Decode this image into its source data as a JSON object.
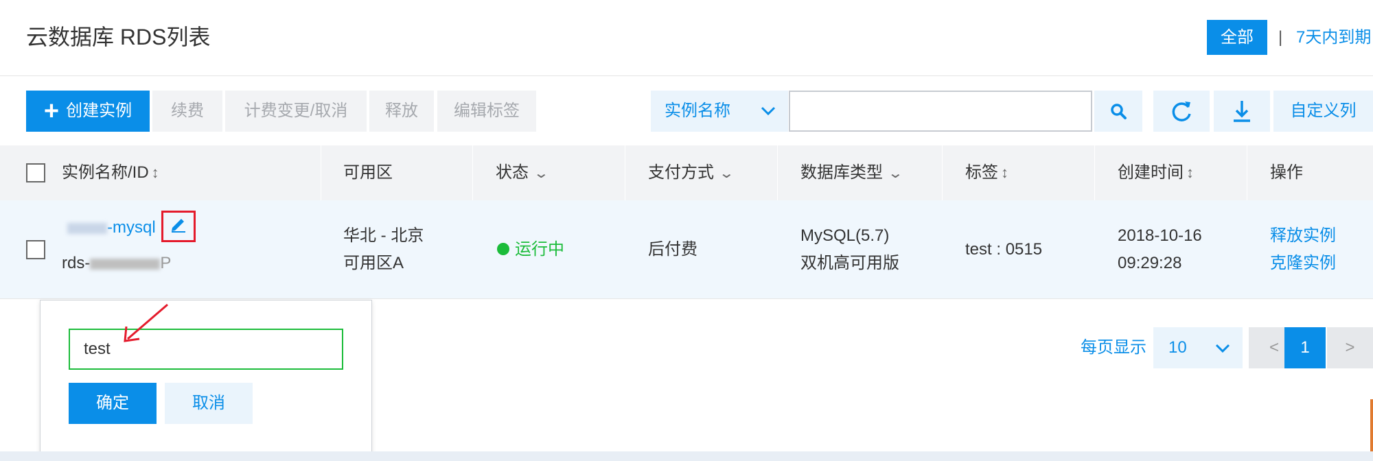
{
  "header": {
    "title": "云数据库 RDS列表",
    "filter_all": "全部",
    "separator": "|",
    "filter_expiring": "7天内到期"
  },
  "toolbar": {
    "create": "创建实例",
    "renew": "续费",
    "billing": "计费变更/取消",
    "release": "释放",
    "edit_tags": "编辑标签",
    "search_type": "实例名称",
    "search_value": "",
    "custom_columns": "自定义列"
  },
  "table": {
    "headers": [
      "实例名称/ID",
      "可用区",
      "状态",
      "支付方式",
      "数据库类型",
      "标签",
      "创建时间",
      "操作"
    ],
    "rows": [
      {
        "name_suffix": "-mysql",
        "id_prefix": "rds-",
        "id_suffix": "P",
        "zone_line1": "华北 - 北京",
        "zone_line2": "可用区A",
        "status": "运行中",
        "payment": "后付费",
        "db_type_line1": "MySQL(5.7)",
        "db_type_line2": "双机高可用版",
        "tag": "test : 0515",
        "created_date": "2018-10-16",
        "created_time": "09:29:28",
        "action_release": "释放实例",
        "action_clone": "克隆实例"
      }
    ]
  },
  "popup": {
    "value": "test",
    "confirm": "确定",
    "cancel": "取消"
  },
  "pagination": {
    "per_page_label": "每页显示",
    "per_page": "10",
    "prev": "<",
    "current": "1",
    "next": ">"
  },
  "colors": {
    "accent": "#0a8ee8",
    "status_running": "#1bbc3a",
    "highlight": "#e41b2c"
  }
}
